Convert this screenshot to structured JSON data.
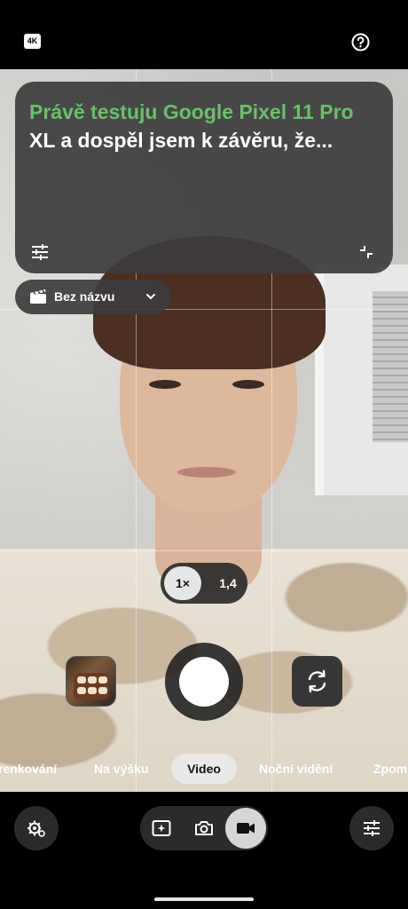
{
  "top_bar": {
    "resolution_badge": "4K",
    "help_icon": "help-circle-icon"
  },
  "caption_card": {
    "text_highlight": "Právě testuju Google Pixel 11 Pro",
    "text_rest": "XL a dospěl jsem k závěru, že...",
    "settings_icon": "sliders-icon",
    "collapse_icon": "collapse-icon"
  },
  "title_chip": {
    "label": "Bez názvu",
    "icon": "clapperboard-icon",
    "chevron": "chevron-down-icon"
  },
  "zoom": {
    "options": [
      "1×",
      "1,4"
    ],
    "selected": "1×"
  },
  "modes": {
    "items": [
      "renkování",
      "Na výšku",
      "Video",
      "Noční vidění",
      "Zpom"
    ],
    "active": "Video"
  },
  "bottom_bar": {
    "left_icon": "settings-gear-icon",
    "right_icon": "sliders-icon",
    "capture_types": [
      "sparkle-frame-icon",
      "camera-icon",
      "video-camera-icon"
    ],
    "active_type": "video-camera-icon"
  },
  "colors": {
    "caption_highlight": "#6bbf6a",
    "overlay_bg": "#3c3c3c",
    "shutter": "#ffffff"
  }
}
